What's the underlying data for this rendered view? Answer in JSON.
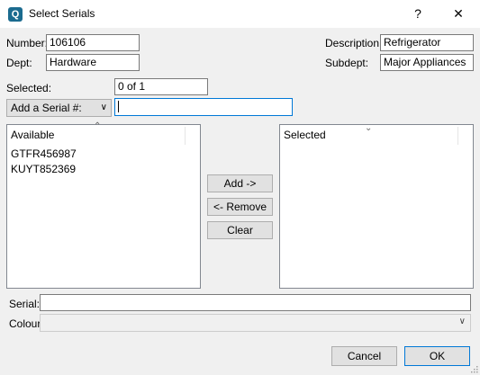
{
  "window": {
    "title": "Select Serials",
    "app_icon": "Q",
    "help_label": "?",
    "close_label": "✕"
  },
  "form": {
    "number_label": "Number:",
    "number_value": "106106",
    "dept_label": "Dept:",
    "dept_value": "Hardware",
    "description_label": "Description:",
    "description_value": "Refrigerator",
    "subdept_label": "Subdept:",
    "subdept_value": "Major Appliances",
    "selected_label": "Selected:",
    "selected_value": "0 of 1",
    "add_serial_combo": "Add a Serial #:",
    "add_serial_input": ""
  },
  "available": {
    "header": "Available",
    "items": [
      "GTFR456987",
      "KUYT852369"
    ]
  },
  "selected_list": {
    "header": "Selected",
    "items": []
  },
  "actions": {
    "add_label": "Add ->",
    "remove_label": "<- Remove",
    "clear_label": "Clear"
  },
  "bottom": {
    "serial_label": "Serial:",
    "serial_value": "",
    "colour_label": "Colour",
    "colour_value": ""
  },
  "footer": {
    "cancel_label": "Cancel",
    "ok_label": "OK"
  },
  "icons": {
    "app": "app-icon",
    "chevron": "chevron-down-icon",
    "sort": "sort-indicator-icon",
    "help": "help-icon",
    "close": "close-icon"
  }
}
